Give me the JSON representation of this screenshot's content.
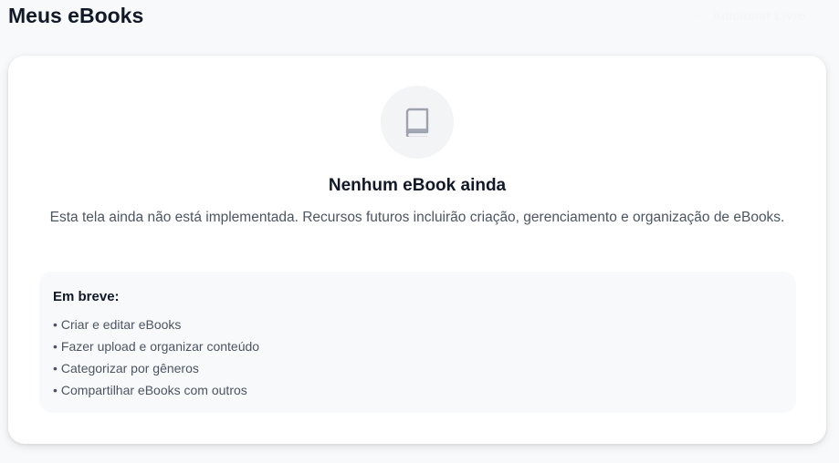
{
  "header": {
    "title": "Meus eBooks",
    "add_button_icon": "+",
    "add_button_label": "Adicionar Livro"
  },
  "empty_state": {
    "icon": "book-icon",
    "title": "Nenhum eBook ainda",
    "description": "Esta tela ainda não está implementada. Recursos futuros incluirão criação, gerenciamento e organização de eBooks."
  },
  "coming_soon": {
    "title": "Em breve:",
    "items": [
      "Criar e editar eBooks",
      "Fazer upload e organizar conteúdo",
      "Categorizar por gêneros",
      "Compartilhar eBooks com outros"
    ]
  },
  "colors": {
    "page_background": "#f8f9fa",
    "card_background": "#ffffff",
    "text_primary": "#111827",
    "text_secondary": "#4b5563",
    "icon_gray": "#9ca3af"
  }
}
